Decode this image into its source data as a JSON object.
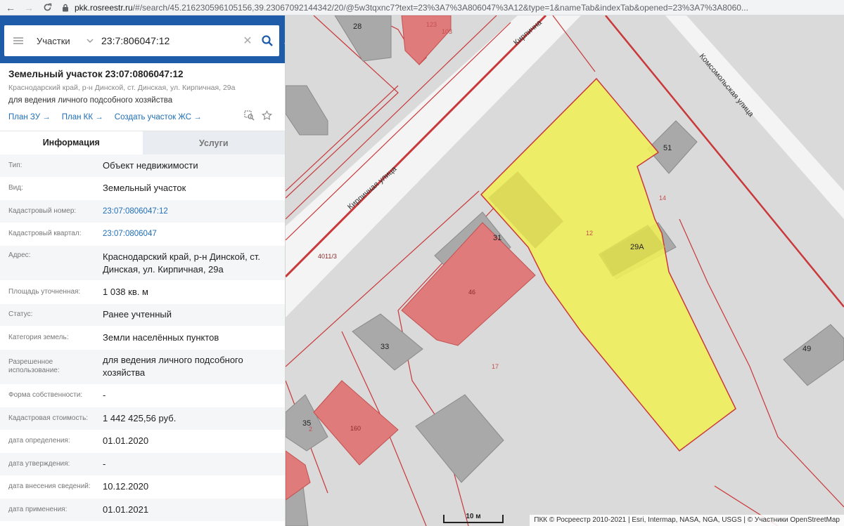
{
  "browser": {
    "host": "pkk.rosreestr.ru",
    "path": "/#/search/45.216230596105156,39.23067092144342/20/@5w3tqxnc7?text=23%3A7%3A806047%3A12&type=1&nameTab&indexTab&opened=23%3A7%3A8060..."
  },
  "search": {
    "type_label": "Участки",
    "query": "23:7:806047:12"
  },
  "parcel": {
    "title": "Земельный участок 23:07:0806047:12",
    "address": "Краснодарский край, р-н Динской, ст. Динская, ул. Кирпичная, 29а",
    "purpose": "для ведения личного подсобного хозяйства",
    "links": [
      "План ЗУ →",
      "План КК →",
      "Создать участок ЖС →"
    ]
  },
  "tabs": [
    "Информация",
    "Услуги"
  ],
  "info": [
    {
      "label": "Тип:",
      "value": "Объект недвижимости"
    },
    {
      "label": "Вид:",
      "value": "Земельный участок"
    },
    {
      "label": "Кадастровый номер:",
      "value": "23:07:0806047:12",
      "link": true
    },
    {
      "label": "Кадастровый квартал:",
      "value": "23:07:0806047",
      "link": true
    },
    {
      "label": "Адрес:",
      "value": "Краснодарский край, р-н Динской, ст. Динская, ул. Кирпичная, 29а"
    },
    {
      "label": "Площадь уточненная:",
      "value": "1 038 кв. м"
    },
    {
      "label": "Статус:",
      "value": "Ранее учтенный"
    },
    {
      "label": "Категория земель:",
      "value": "Земли населённых пунктов"
    },
    {
      "label": "Разрешенное использование:",
      "value": "для ведения личного подсобного хозяйства"
    },
    {
      "label": "Форма собственности:",
      "value": "-"
    },
    {
      "label": "Кадастровая стоимость:",
      "value": "1 442 425,56 руб."
    },
    {
      "label": "дата определения:",
      "value": "01.01.2020"
    },
    {
      "label": "дата утверждения:",
      "value": "-"
    },
    {
      "label": "дата внесения сведений:",
      "value": "10.12.2020"
    },
    {
      "label": "дата применения:",
      "value": "01.01.2021"
    }
  ],
  "map": {
    "street_kirpichnaya": "Кирпичная улица",
    "street_kirpichna_top": "Кирпична",
    "street_komsomolskaya": "Комсомольская улица",
    "building_labels": [
      "28",
      "123",
      "103",
      "51",
      "14",
      "12",
      "31",
      "29А",
      "46",
      "33",
      "17",
      "49",
      "35",
      "2",
      "160",
      "4011/3"
    ],
    "scale": "10 м",
    "attribution": "ПКК © Росреестр 2010-2021 | Esri, Intermap, NASA, NGA, USGS | © Участники OpenStreetMap"
  },
  "colors": {
    "header_blue": "#1e5ba8",
    "link_blue": "#1f6fb8",
    "parcel_yellow": "#f0ee5a",
    "parcel_border": "#c9383a",
    "building_red": "#e07b7b",
    "building_gray": "#a9a9a9"
  }
}
